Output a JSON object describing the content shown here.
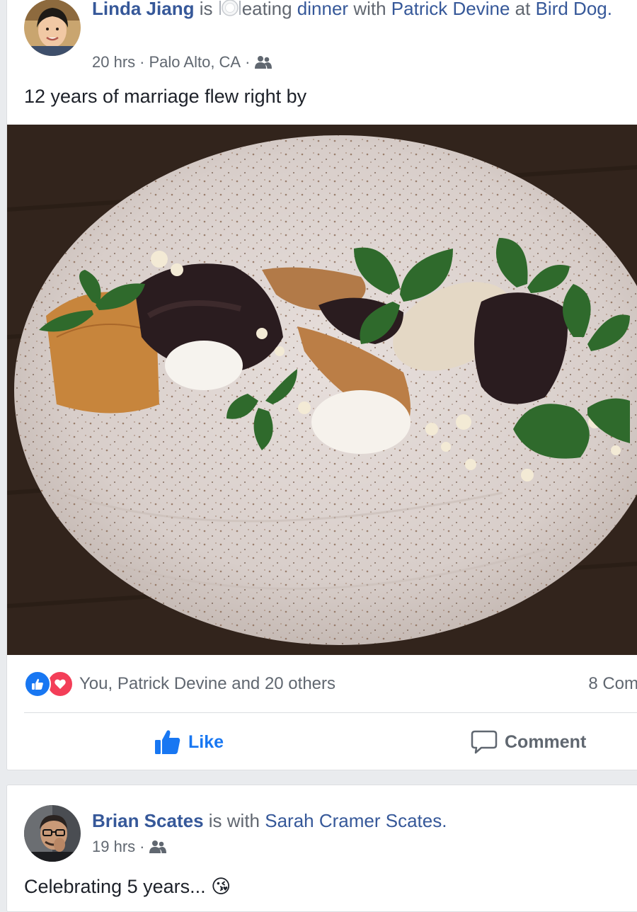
{
  "colors": {
    "link": "#365899",
    "like_blue": "#1877f2",
    "love_red": "#f33e58",
    "meta_gray": "#606770"
  },
  "post1": {
    "author": "Linda Jiang",
    "is_text": "is",
    "activity_icon": "plate-icon",
    "activity_verb": "eating",
    "activity_object": "dinner",
    "with_text": "with",
    "tagged": "Patrick Devine",
    "at_text": "at",
    "place": "Bird Dog.",
    "time": "20 hrs",
    "separator": "·",
    "location": "Palo Alto, CA",
    "audience_icon": "friends-icon",
    "text": "12 years of marriage flew right by",
    "photo_description_icon": "dessert-plate-photo",
    "reactions": {
      "icons": [
        "like-icon",
        "love-icon"
      ],
      "summary": "You, Patrick Devine and 20 others",
      "comments": "8 Com"
    },
    "actions": {
      "like": "Like",
      "comment": "Comment"
    }
  },
  "post2": {
    "author": "Brian Scates",
    "is_with_text": "is with",
    "tagged": "Sarah Cramer Scates.",
    "time": "19 hrs",
    "separator": "·",
    "audience_icon": "friends-icon",
    "text": "Celebrating 5 years... 😘"
  }
}
